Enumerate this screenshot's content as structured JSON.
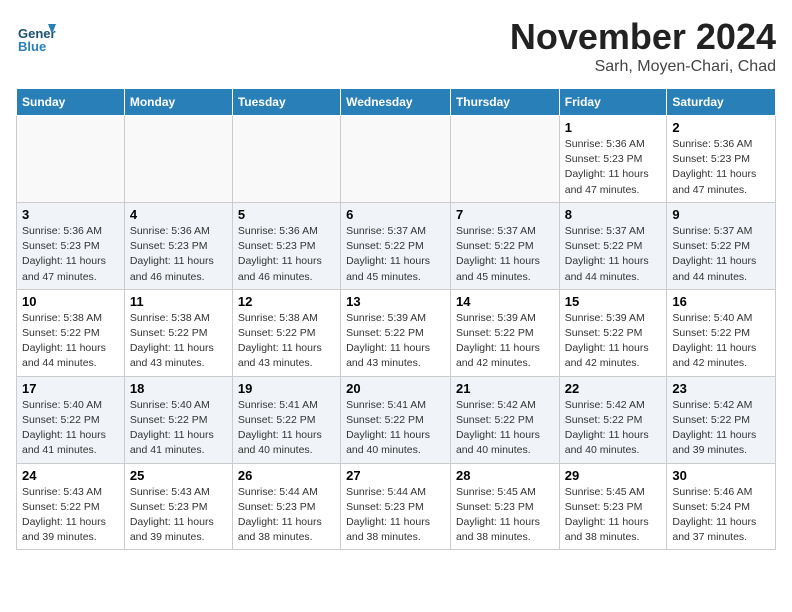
{
  "header": {
    "logo_line1": "General",
    "logo_line2": "Blue",
    "month": "November 2024",
    "location": "Sarh, Moyen-Chari, Chad"
  },
  "weekdays": [
    "Sunday",
    "Monday",
    "Tuesday",
    "Wednesday",
    "Thursday",
    "Friday",
    "Saturday"
  ],
  "weeks": [
    [
      {
        "day": "",
        "info": ""
      },
      {
        "day": "",
        "info": ""
      },
      {
        "day": "",
        "info": ""
      },
      {
        "day": "",
        "info": ""
      },
      {
        "day": "",
        "info": ""
      },
      {
        "day": "1",
        "info": "Sunrise: 5:36 AM\nSunset: 5:23 PM\nDaylight: 11 hours and 47 minutes."
      },
      {
        "day": "2",
        "info": "Sunrise: 5:36 AM\nSunset: 5:23 PM\nDaylight: 11 hours and 47 minutes."
      }
    ],
    [
      {
        "day": "3",
        "info": "Sunrise: 5:36 AM\nSunset: 5:23 PM\nDaylight: 11 hours and 47 minutes."
      },
      {
        "day": "4",
        "info": "Sunrise: 5:36 AM\nSunset: 5:23 PM\nDaylight: 11 hours and 46 minutes."
      },
      {
        "day": "5",
        "info": "Sunrise: 5:36 AM\nSunset: 5:23 PM\nDaylight: 11 hours and 46 minutes."
      },
      {
        "day": "6",
        "info": "Sunrise: 5:37 AM\nSunset: 5:22 PM\nDaylight: 11 hours and 45 minutes."
      },
      {
        "day": "7",
        "info": "Sunrise: 5:37 AM\nSunset: 5:22 PM\nDaylight: 11 hours and 45 minutes."
      },
      {
        "day": "8",
        "info": "Sunrise: 5:37 AM\nSunset: 5:22 PM\nDaylight: 11 hours and 44 minutes."
      },
      {
        "day": "9",
        "info": "Sunrise: 5:37 AM\nSunset: 5:22 PM\nDaylight: 11 hours and 44 minutes."
      }
    ],
    [
      {
        "day": "10",
        "info": "Sunrise: 5:38 AM\nSunset: 5:22 PM\nDaylight: 11 hours and 44 minutes."
      },
      {
        "day": "11",
        "info": "Sunrise: 5:38 AM\nSunset: 5:22 PM\nDaylight: 11 hours and 43 minutes."
      },
      {
        "day": "12",
        "info": "Sunrise: 5:38 AM\nSunset: 5:22 PM\nDaylight: 11 hours and 43 minutes."
      },
      {
        "day": "13",
        "info": "Sunrise: 5:39 AM\nSunset: 5:22 PM\nDaylight: 11 hours and 43 minutes."
      },
      {
        "day": "14",
        "info": "Sunrise: 5:39 AM\nSunset: 5:22 PM\nDaylight: 11 hours and 42 minutes."
      },
      {
        "day": "15",
        "info": "Sunrise: 5:39 AM\nSunset: 5:22 PM\nDaylight: 11 hours and 42 minutes."
      },
      {
        "day": "16",
        "info": "Sunrise: 5:40 AM\nSunset: 5:22 PM\nDaylight: 11 hours and 42 minutes."
      }
    ],
    [
      {
        "day": "17",
        "info": "Sunrise: 5:40 AM\nSunset: 5:22 PM\nDaylight: 11 hours and 41 minutes."
      },
      {
        "day": "18",
        "info": "Sunrise: 5:40 AM\nSunset: 5:22 PM\nDaylight: 11 hours and 41 minutes."
      },
      {
        "day": "19",
        "info": "Sunrise: 5:41 AM\nSunset: 5:22 PM\nDaylight: 11 hours and 40 minutes."
      },
      {
        "day": "20",
        "info": "Sunrise: 5:41 AM\nSunset: 5:22 PM\nDaylight: 11 hours and 40 minutes."
      },
      {
        "day": "21",
        "info": "Sunrise: 5:42 AM\nSunset: 5:22 PM\nDaylight: 11 hours and 40 minutes."
      },
      {
        "day": "22",
        "info": "Sunrise: 5:42 AM\nSunset: 5:22 PM\nDaylight: 11 hours and 40 minutes."
      },
      {
        "day": "23",
        "info": "Sunrise: 5:42 AM\nSunset: 5:22 PM\nDaylight: 11 hours and 39 minutes."
      }
    ],
    [
      {
        "day": "24",
        "info": "Sunrise: 5:43 AM\nSunset: 5:22 PM\nDaylight: 11 hours and 39 minutes."
      },
      {
        "day": "25",
        "info": "Sunrise: 5:43 AM\nSunset: 5:23 PM\nDaylight: 11 hours and 39 minutes."
      },
      {
        "day": "26",
        "info": "Sunrise: 5:44 AM\nSunset: 5:23 PM\nDaylight: 11 hours and 38 minutes."
      },
      {
        "day": "27",
        "info": "Sunrise: 5:44 AM\nSunset: 5:23 PM\nDaylight: 11 hours and 38 minutes."
      },
      {
        "day": "28",
        "info": "Sunrise: 5:45 AM\nSunset: 5:23 PM\nDaylight: 11 hours and 38 minutes."
      },
      {
        "day": "29",
        "info": "Sunrise: 5:45 AM\nSunset: 5:23 PM\nDaylight: 11 hours and 38 minutes."
      },
      {
        "day": "30",
        "info": "Sunrise: 5:46 AM\nSunset: 5:24 PM\nDaylight: 11 hours and 37 minutes."
      }
    ]
  ]
}
